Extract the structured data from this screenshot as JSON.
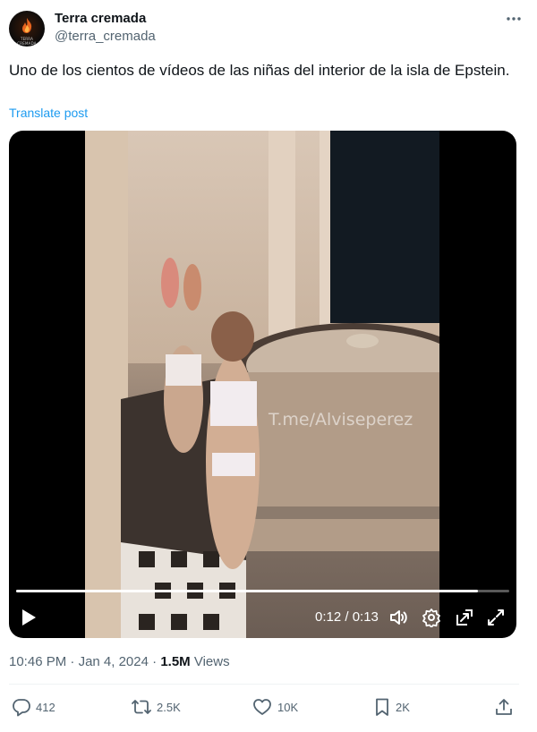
{
  "user": {
    "display_name": "Terra cremada",
    "handle": "@terra_cremada",
    "avatar_caption": "TERRA CREMADA"
  },
  "post": {
    "text": "Uno de los cientos de vídeos de las niñas del interior de la isla de Epstein.",
    "translate_label": "Translate post"
  },
  "video": {
    "watermark": "T.me/Alviseperez",
    "time_display": "0:12 / 0:13",
    "progress": 0.937
  },
  "meta": {
    "time": "10:46 PM",
    "date": "Jan 4, 2024",
    "views_count": "1.5M",
    "views_label": "Views"
  },
  "actions": {
    "replies": "412",
    "reposts": "2.5K",
    "likes": "10K",
    "bookmarks": "2K"
  },
  "colors": {
    "link": "#1d9bf0",
    "secondary_text": "#536471",
    "primary_text": "#0f1419"
  }
}
